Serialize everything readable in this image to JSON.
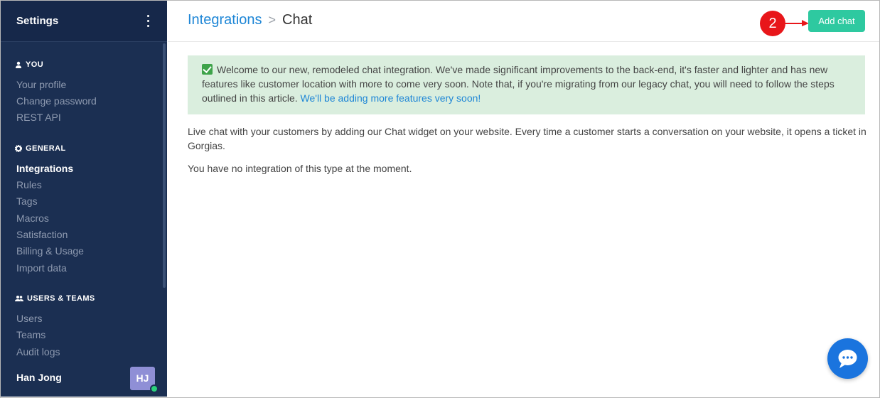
{
  "sidebar": {
    "title": "Settings",
    "sections": {
      "you": {
        "label": "YOU",
        "items": [
          "Your profile",
          "Change password",
          "REST API"
        ]
      },
      "general": {
        "label": "GENERAL",
        "items": [
          "Integrations",
          "Rules",
          "Tags",
          "Macros",
          "Satisfaction",
          "Billing & Usage",
          "Import data"
        ],
        "active": "Integrations"
      },
      "users_teams": {
        "label": "USERS & TEAMS",
        "items": [
          "Users",
          "Teams",
          "Audit logs"
        ]
      }
    },
    "user": {
      "name": "Han Jong",
      "initials": "HJ",
      "status_color": "#2ad07b"
    }
  },
  "header": {
    "breadcrumb": {
      "parent": "Integrations",
      "separator": ">",
      "current": "Chat"
    },
    "step_badge": "2",
    "add_button_label": "Add chat"
  },
  "alert": {
    "text": "Welcome to our new, remodeled chat integration. We've made significant improvements to the back-end, it's faster and lighter and has new features like customer location with more to come very soon. Note that, if you're migrating from our legacy chat, you will need to follow the steps outlined in this article.",
    "link_text": "We'll be adding more features very soon!"
  },
  "content": {
    "description": "Live chat with your customers by adding our Chat widget on your website. Every time a customer starts a conversation on your website, it opens a ticket in Gorgias.",
    "empty_message": "You have no integration of this type at the moment."
  },
  "colors": {
    "sidebar_bg": "#1b2f52",
    "accent": "#2ec9a0",
    "link": "#1e86d6",
    "badge": "#e8161a",
    "chat_widget": "#1a74de"
  }
}
